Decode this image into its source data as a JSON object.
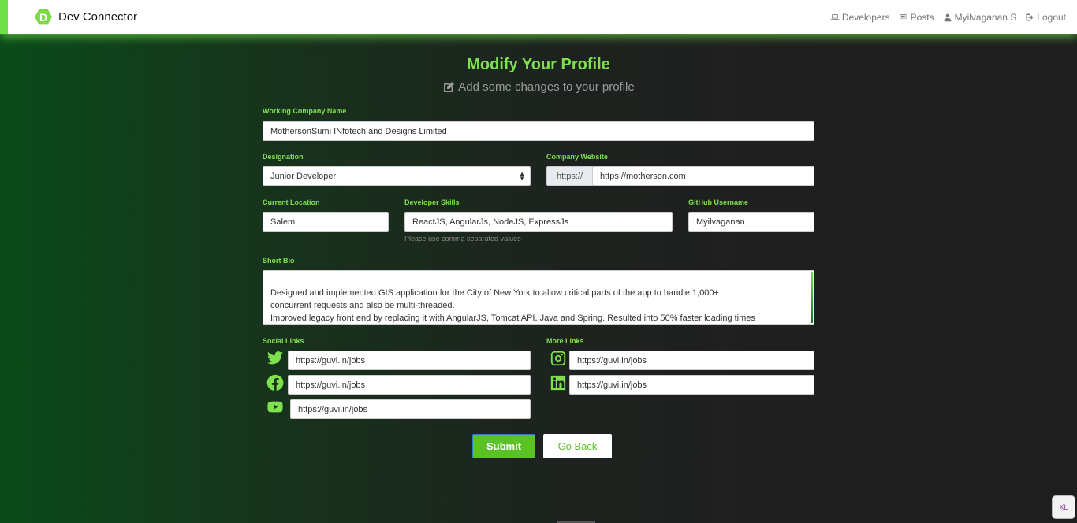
{
  "nav": {
    "brand": "Dev Connector",
    "logo_letter": "D",
    "links": [
      "Developers",
      "Posts",
      "Myilvaganan S",
      "Logout"
    ]
  },
  "header": {
    "title": "Modify Your Profile",
    "subtitle": "Add some changes to your profile"
  },
  "form": {
    "company": {
      "label": "Working Company Name",
      "value": "MothersonSumi INfotech and Designs Limited"
    },
    "designation": {
      "label": "Designation",
      "value": "Junior Developer"
    },
    "website": {
      "label": "Company Website",
      "prefix": "https://",
      "value": "https://motherson.com"
    },
    "location": {
      "label": "Current Location",
      "value": "Salem"
    },
    "skills": {
      "label": "Developer Skills",
      "value": "ReactJS, AngularJs, NodeJS, ExpressJs",
      "hint": "Please use comma separated values"
    },
    "github": {
      "label": "GitHub Username",
      "value": "Myilvaganan"
    },
    "bio": {
      "label": "Short Bio",
      "line1": "Designed and implemented GIS application for the City of New York to allow critical parts of the app to handle 1,000+",
      "line2": "concurrent requests and also be multi-threaded.",
      "line3": "Improved legacy front end by replacing it with AngularJS, Tomcat API, Java and Spring. Resulted into 50% faster loading times"
    },
    "social": {
      "label": "Social Links",
      "twitter": "https://guvi.in/jobs",
      "facebook": "https://guvi.in/jobs",
      "youtube": "https://guvi.in/jobs"
    },
    "more": {
      "label": "More Links",
      "instagram": "https://guvi.in/jobs",
      "linkedin": "https://guvi.in/jobs"
    },
    "submit": "Submit",
    "back": "Go Back"
  },
  "badge": "XL",
  "colors": {
    "accent": "#7ee04f",
    "button": "#5ac225"
  }
}
